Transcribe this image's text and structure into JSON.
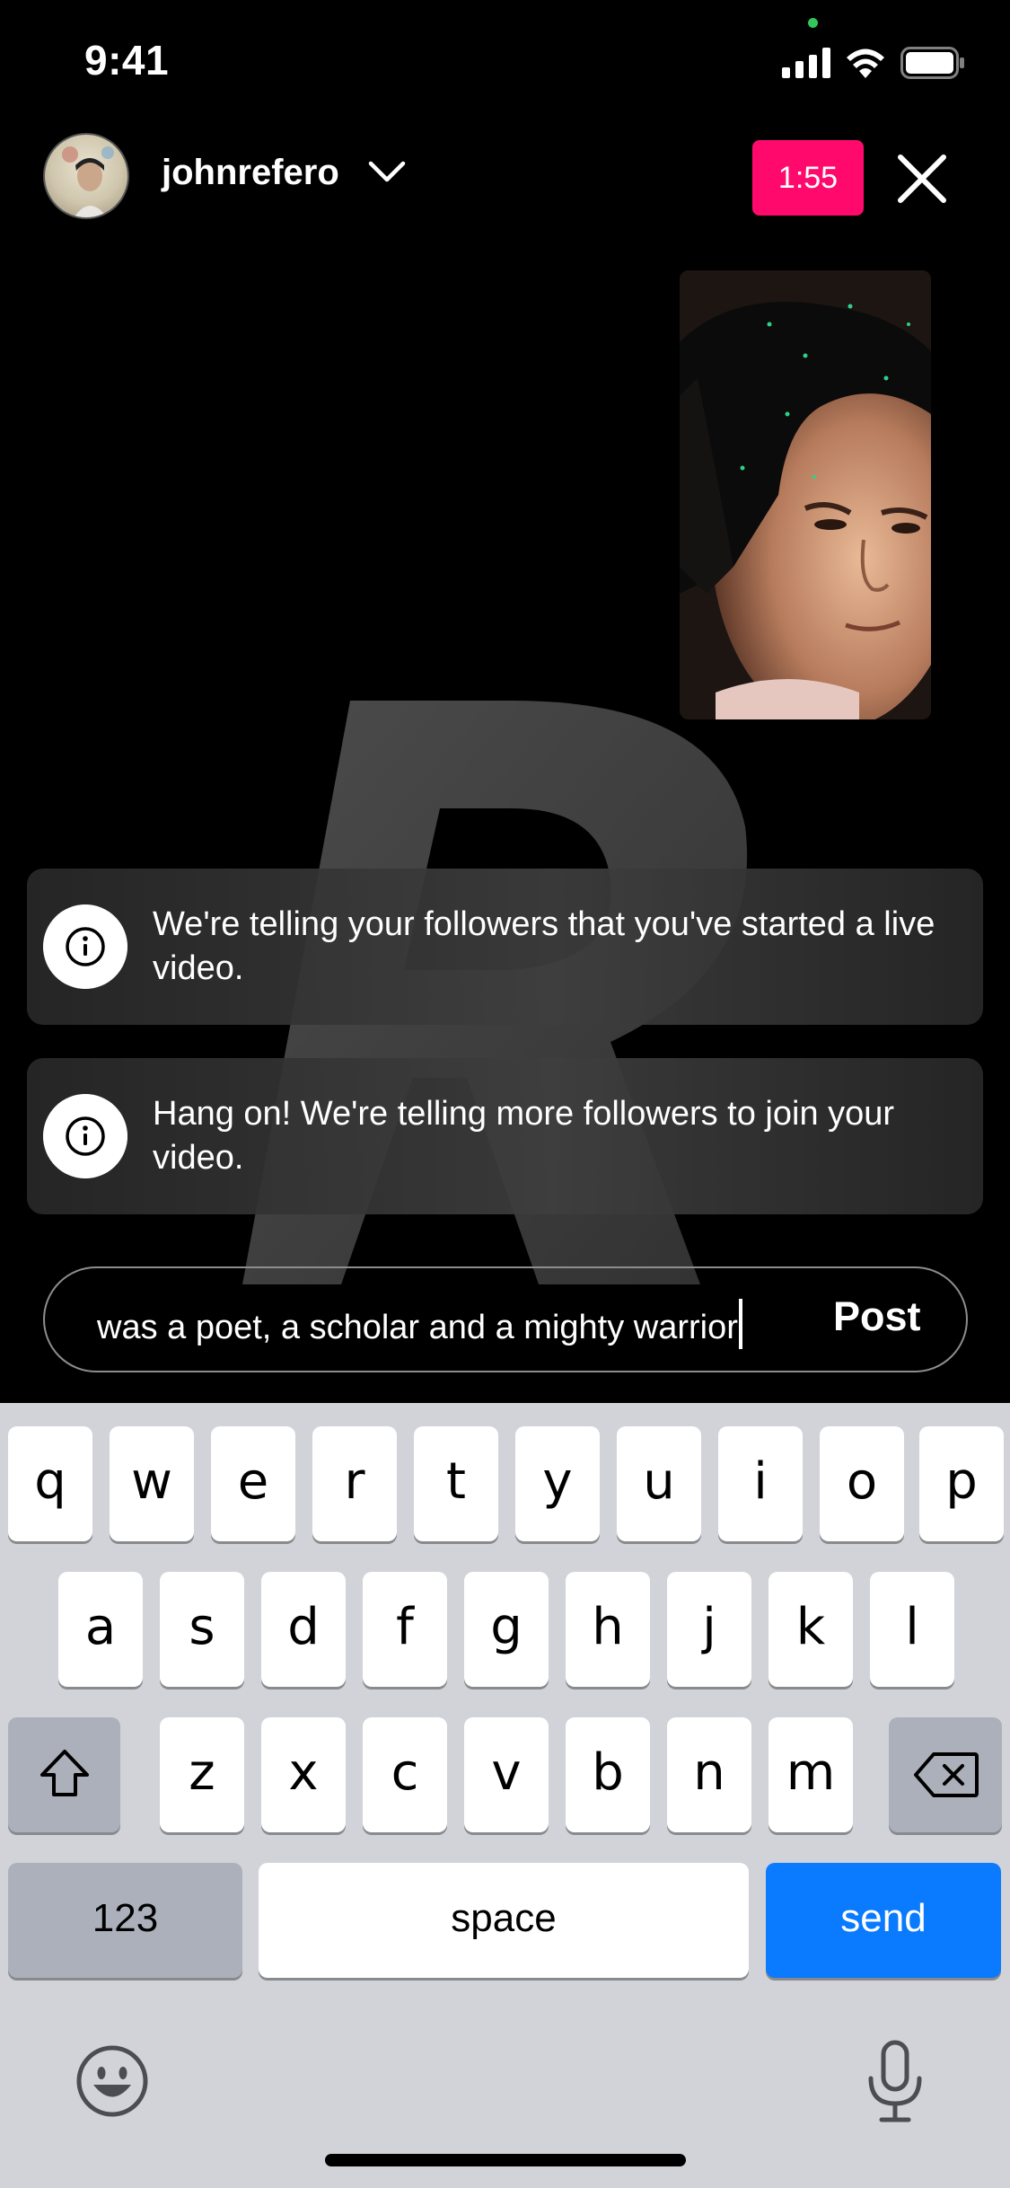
{
  "status_bar": {
    "time": "9:41"
  },
  "header": {
    "username": "johnrefero",
    "timer": "1:55"
  },
  "notices": [
    {
      "text": "We're telling your followers that you've started a live video."
    },
    {
      "text": "Hang on! We're telling more followers to join your video."
    }
  ],
  "comment": {
    "value": "was a poet, a scholar and a mighty warrior",
    "post_label": "Post"
  },
  "keyboard": {
    "row1": [
      "q",
      "w",
      "e",
      "r",
      "t",
      "y",
      "u",
      "i",
      "o",
      "p"
    ],
    "row2": [
      "a",
      "s",
      "d",
      "f",
      "g",
      "h",
      "j",
      "k",
      "l"
    ],
    "row3": [
      "z",
      "x",
      "c",
      "v",
      "b",
      "n",
      "m"
    ],
    "numbers_label": "123",
    "space_label": "space",
    "send_label": "send"
  },
  "colors": {
    "live_timer": "#ff0a6c",
    "send_key": "#0a7aff",
    "keyboard_bg": "#d1d3d9"
  }
}
